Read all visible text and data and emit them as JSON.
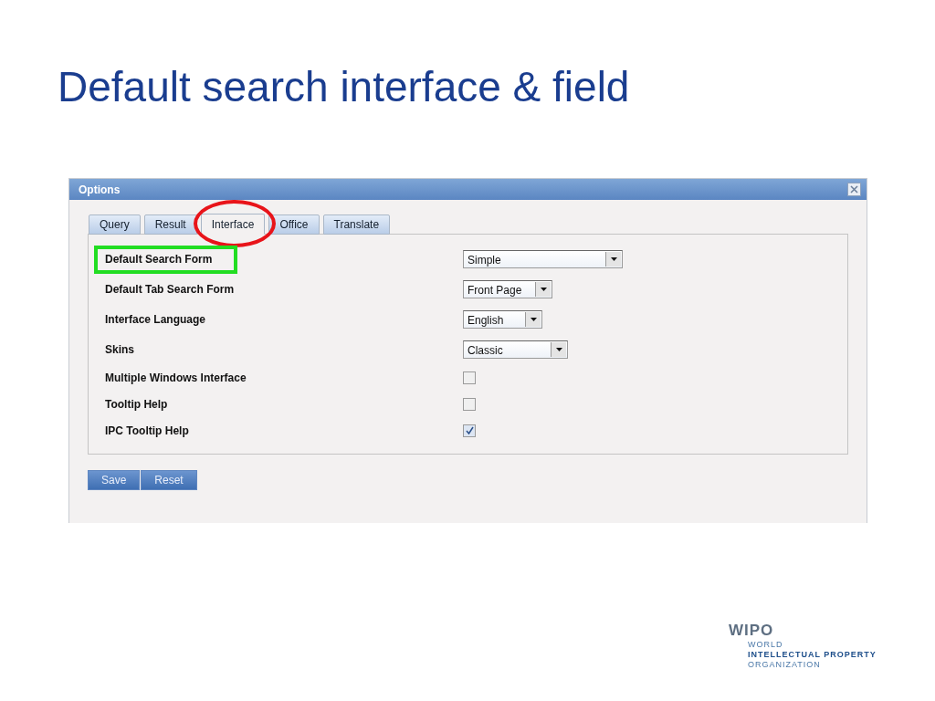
{
  "slide_title": "Default search interface & field",
  "dialog": {
    "title": "Options",
    "tabs": [
      {
        "label": "Query",
        "selected": false
      },
      {
        "label": "Result",
        "selected": false
      },
      {
        "label": "Interface",
        "selected": true
      },
      {
        "label": "Office",
        "selected": false
      },
      {
        "label": "Translate",
        "selected": false
      }
    ],
    "settings": [
      {
        "kind": "select",
        "label": "Default Search Form",
        "value": "Simple"
      },
      {
        "kind": "select",
        "label": "Default Tab Search Form",
        "value": "Front Page"
      },
      {
        "kind": "select",
        "label": "Interface Language",
        "value": "English"
      },
      {
        "kind": "select",
        "label": "Skins",
        "value": "Classic"
      },
      {
        "kind": "checkbox",
        "label": "Multiple Windows Interface",
        "checked": false
      },
      {
        "kind": "checkbox",
        "label": "Tooltip Help",
        "checked": false
      },
      {
        "kind": "checkbox",
        "label": "IPC Tooltip Help",
        "checked": true
      }
    ],
    "buttons": [
      "Save",
      "Reset"
    ]
  },
  "annotations": [
    {
      "kind": "ellipse"
    },
    {
      "kind": "frame"
    }
  ],
  "logo": {
    "name": "WIPO",
    "lines": [
      "WORLD",
      "INTELLECTUAL PROPERTY",
      "ORGANIZATION"
    ]
  }
}
